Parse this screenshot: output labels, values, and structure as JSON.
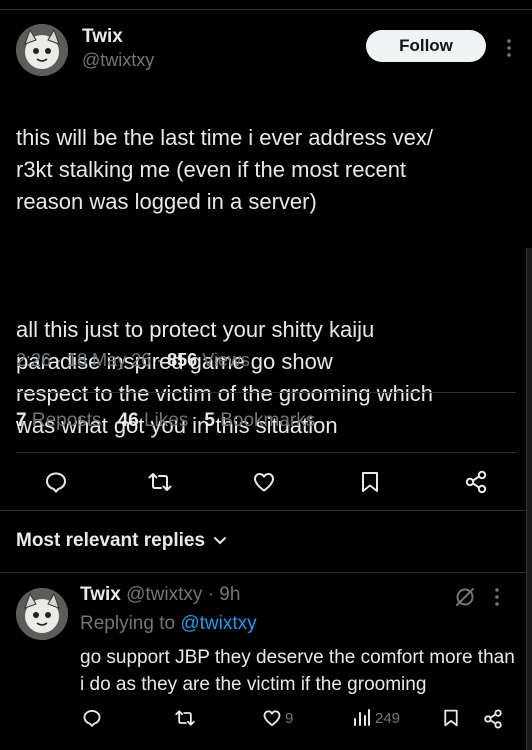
{
  "tweet": {
    "author": {
      "name": "Twix",
      "handle": "@twixtxy"
    },
    "follow_label": "Follow",
    "body": [
      "this will be the last time i ever address vex/\nr3kt stalking me (even if the most recent\nreason was logged in a server)",
      "all this just to protect your shitty kaiju\nparadise inspired game go show\nrespect to the victim of the grooming which\nwas what got you in this situation"
    ],
    "time": "2:26",
    "date": "18 May 26",
    "views_count": "856",
    "views_label": "Views",
    "stats": {
      "reposts": {
        "count": "7",
        "label": "Reposts"
      },
      "likes": {
        "count": "46",
        "label": "Likes"
      },
      "bookmarks": {
        "count": "5",
        "label": "Bookmarks"
      }
    },
    "actions": [
      "reply-icon",
      "repost-icon",
      "like-icon",
      "bookmark-icon",
      "share-icon"
    ]
  },
  "replies_filter": {
    "label": "Most relevant replies"
  },
  "reply": {
    "author": {
      "name": "Twix",
      "handle": "@twixtxy",
      "age": "9h"
    },
    "replying_prefix": "Replying to",
    "replying_handle": "@twixtxy",
    "body": "go support JBP they deserve the comfort more than i do as they are the victim if the grooming",
    "likes": "9",
    "views": "249"
  },
  "colors": {
    "background": "#000000",
    "text": "#e7e9ea",
    "muted": "#71767b",
    "accent": "#1d9bf0",
    "divider": "#2f3336",
    "follow_bg": "#eff3f4"
  }
}
